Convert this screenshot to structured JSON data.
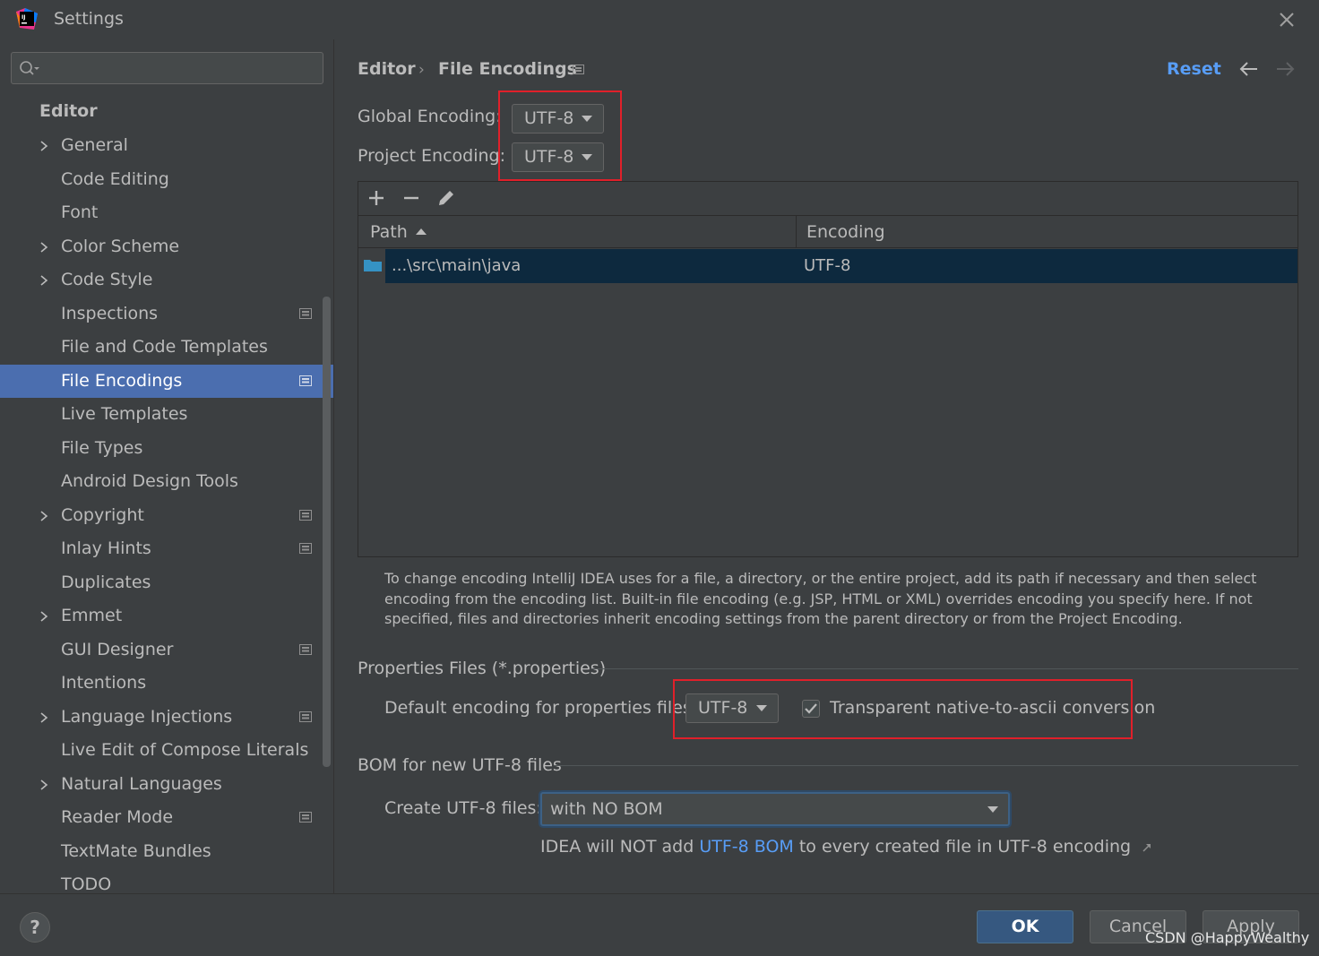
{
  "window": {
    "title": "Settings"
  },
  "sidebar": {
    "search_placeholder": "",
    "section": "Editor",
    "items": [
      {
        "label": "General",
        "chevron": true,
        "project_icon": false
      },
      {
        "label": "Code Editing",
        "chevron": false,
        "project_icon": false
      },
      {
        "label": "Font",
        "chevron": false,
        "project_icon": false
      },
      {
        "label": "Color Scheme",
        "chevron": true,
        "project_icon": false
      },
      {
        "label": "Code Style",
        "chevron": true,
        "project_icon": false
      },
      {
        "label": "Inspections",
        "chevron": false,
        "project_icon": true
      },
      {
        "label": "File and Code Templates",
        "chevron": false,
        "project_icon": false
      },
      {
        "label": "File Encodings",
        "chevron": false,
        "project_icon": true,
        "selected": true
      },
      {
        "label": "Live Templates",
        "chevron": false,
        "project_icon": false
      },
      {
        "label": "File Types",
        "chevron": false,
        "project_icon": false
      },
      {
        "label": "Android Design Tools",
        "chevron": false,
        "project_icon": false
      },
      {
        "label": "Copyright",
        "chevron": true,
        "project_icon": true
      },
      {
        "label": "Inlay Hints",
        "chevron": false,
        "project_icon": true
      },
      {
        "label": "Duplicates",
        "chevron": false,
        "project_icon": false
      },
      {
        "label": "Emmet",
        "chevron": true,
        "project_icon": false
      },
      {
        "label": "GUI Designer",
        "chevron": false,
        "project_icon": true
      },
      {
        "label": "Intentions",
        "chevron": false,
        "project_icon": false
      },
      {
        "label": "Language Injections",
        "chevron": true,
        "project_icon": true
      },
      {
        "label": "Live Edit of Compose Literals",
        "chevron": false,
        "project_icon": false
      },
      {
        "label": "Natural Languages",
        "chevron": true,
        "project_icon": false
      },
      {
        "label": "Reader Mode",
        "chevron": false,
        "project_icon": true
      },
      {
        "label": "TextMate Bundles",
        "chevron": false,
        "project_icon": false
      },
      {
        "label": "TODO",
        "chevron": false,
        "project_icon": false
      }
    ]
  },
  "header": {
    "breadcrumb_parent": "Editor",
    "breadcrumb_current": "File Encodings",
    "separator": "›",
    "reset_label": "Reset"
  },
  "encodings": {
    "global_label": "Global Encoding:",
    "global_value": "UTF-8",
    "project_label": "Project Encoding:",
    "project_value": "UTF-8"
  },
  "table": {
    "columns": [
      "Path",
      "Encoding"
    ],
    "rows": [
      {
        "path": "...\\src\\main\\java",
        "encoding": "UTF-8"
      }
    ]
  },
  "help_text": "To change encoding IntelliJ IDEA uses for a file, a directory, or the entire project, add its path if necessary and then select encoding from the encoding list. Built-in file encoding (e.g. JSP, HTML or XML) overrides encoding you specify here. If not specified, files and directories inherit encoding settings from the parent directory or from the Project Encoding.",
  "properties": {
    "group_title": "Properties Files (*.properties)",
    "default_label": "Default encoding for properties files:",
    "default_value": "UTF-8",
    "native_ascii_label": "Transparent native-to-ascii conversion",
    "native_ascii_checked": true
  },
  "bom": {
    "group_title": "BOM for new UTF-8 files",
    "create_label": "Create UTF-8 files:",
    "create_value": "with NO BOM",
    "note_prefix": "IDEA will NOT add ",
    "note_link": "UTF-8 BOM",
    "note_suffix": " to every created file in UTF-8 encoding"
  },
  "footer": {
    "help_label": "?",
    "ok_label": "OK",
    "cancel_label": "Cancel",
    "apply_label": "Apply",
    "watermark": "CSDN @HappyWealthy"
  },
  "colors": {
    "background": "#3c3f41",
    "selection": "#4b6eaf",
    "accent_link": "#589df6",
    "highlight_box": "#e0202a",
    "table_row_selected": "#0d293e"
  }
}
